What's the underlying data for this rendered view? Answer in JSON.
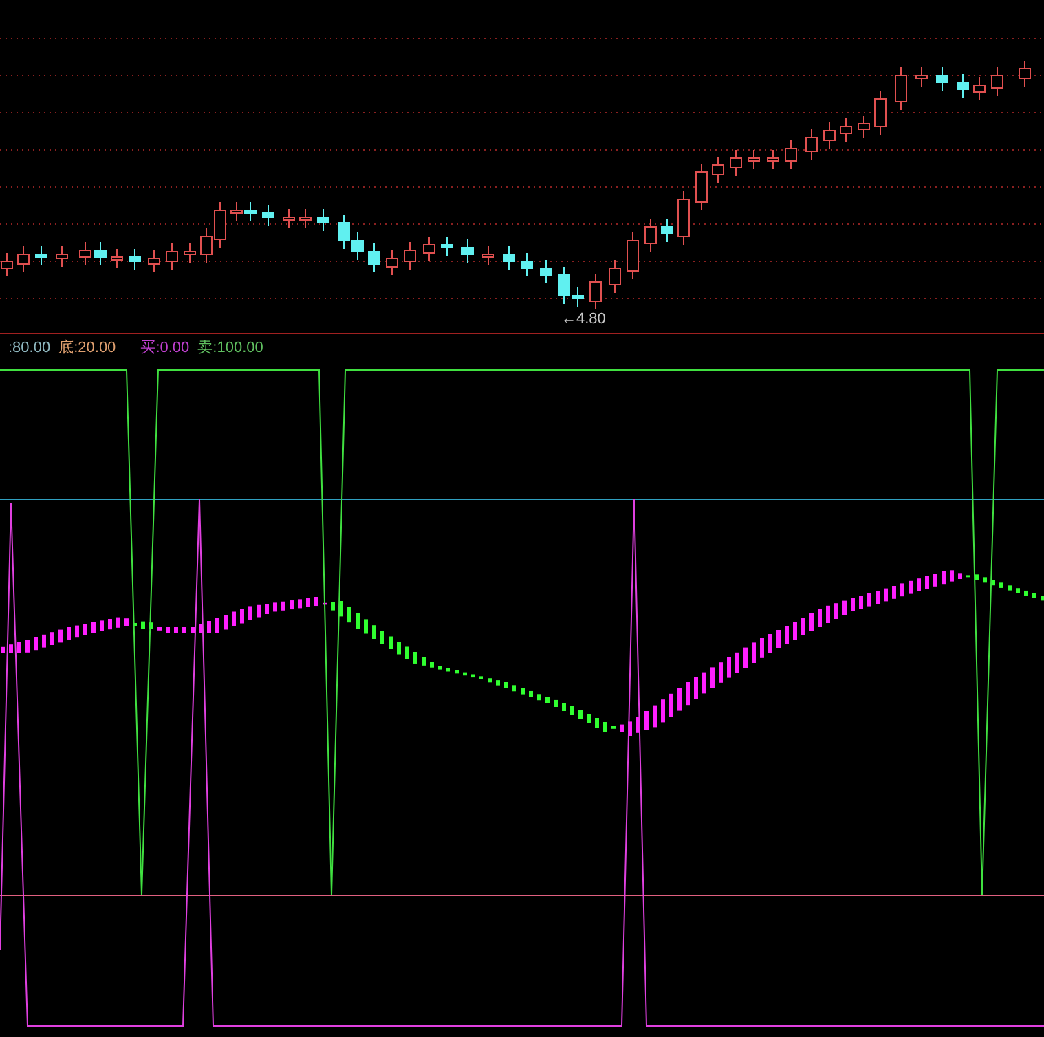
{
  "price_panel": {
    "low_marker": "←4.80"
  },
  "indicator_legend": [
    {
      "label": ":80.00",
      "color": "#8fb8c0"
    },
    {
      "label": "底:20.00",
      "color": "#e0a070"
    },
    {
      "label": "买:0.00",
      "color": "#c040d0"
    },
    {
      "label": "卖:100.00",
      "color": "#60c060"
    }
  ]
}
